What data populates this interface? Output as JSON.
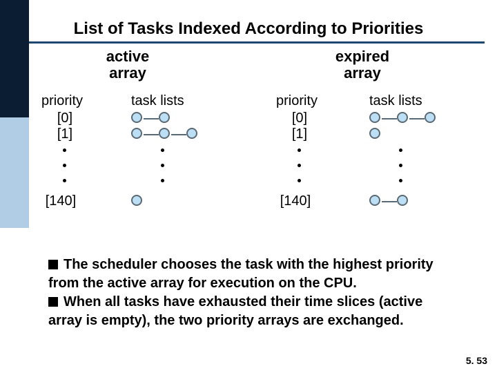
{
  "title": "List of Tasks Indexed According to Priorities",
  "arrays": {
    "active": {
      "heading_l1": "active",
      "heading_l2": "array",
      "priority_label": "priority",
      "tasks_label": "task lists"
    },
    "expired": {
      "heading_l1": "expired",
      "heading_l2": "array",
      "priority_label": "priority",
      "tasks_label": "task lists"
    }
  },
  "rows": {
    "r0": "[0]",
    "r1": "[1]",
    "r140": "[140]"
  },
  "bullets": {
    "b1": "The scheduler chooses the task with the highest priority from the active array for execution on the CPU.",
    "b2": "When all tasks have exhausted their time slices (active array is empty), the two priority arrays are exchanged."
  },
  "pageno": "5. 53",
  "chart_data": {
    "type": "table",
    "description": "Two priority-indexed arrays of task lists (Linux 2.6 scheduler style)",
    "arrays": [
      {
        "name": "active array",
        "task_counts_by_priority": {
          "0": 2,
          "1": 3,
          "140": 1
        }
      },
      {
        "name": "expired array",
        "task_counts_by_priority": {
          "0": 3,
          "1": 1,
          "140": 2
        }
      }
    ],
    "priority_axis": {
      "shown_indices": [
        0,
        1,
        140
      ],
      "ellipsis_between": [
        1,
        140
      ]
    }
  }
}
